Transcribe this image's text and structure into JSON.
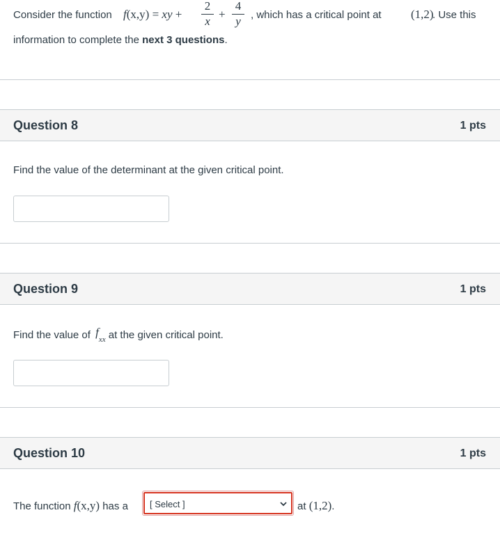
{
  "intro": {
    "consider": "Consider the function",
    "func_name": "f",
    "func_args": "(x,y)",
    "equals": "=",
    "xy": "xy",
    "plus": "+",
    "frac1_num": "2",
    "frac1_den": "x",
    "frac2_num": "4",
    "frac2_den": "y",
    "after_formula": ", which has a critical point at",
    "critical_point": "(1,2)",
    "use_this": ". Use this",
    "line2_pre": "information to complete the",
    "line2_bold": "next 3 questions",
    "line2_post": "."
  },
  "questions": [
    {
      "title": "Question 8",
      "points": "1 pts",
      "prompt": "Find the value of the determinant at the given critical point.",
      "answer": ""
    },
    {
      "title": "Question 9",
      "points": "1 pts",
      "prompt_pre": "Find the value of",
      "f": "f",
      "sub": "xx",
      "prompt_post": "at the given critical point.",
      "answer": ""
    },
    {
      "title": "Question 10",
      "points": "1 pts",
      "prompt_pre": "The function",
      "func": "f",
      "args": "(x,y)",
      "has_a": "has a",
      "select_value": "[ Select ]",
      "at": "at",
      "point": "(1,2)",
      "period": "."
    }
  ],
  "colors": {
    "text": "#2d3b45",
    "header_bg": "#f5f5f5",
    "border": "#c7cdd1",
    "select_error": "#d6331f"
  }
}
